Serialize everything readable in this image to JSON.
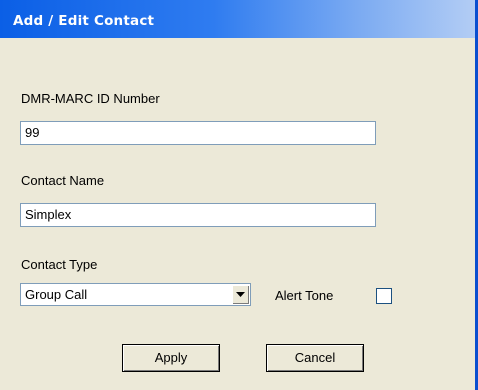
{
  "window": {
    "title": "Add / Edit Contact"
  },
  "form": {
    "id_label": "DMR-MARC ID Number",
    "id_value": "99",
    "name_label": "Contact Name",
    "name_value": "Simplex",
    "type_label": "Contact Type",
    "type_value": "Group Call",
    "alert_label": "Alert Tone",
    "alert_checked": false
  },
  "buttons": {
    "apply_label": "Apply",
    "cancel_label": "Cancel"
  },
  "colors": {
    "title_bar": "#0b5fe6",
    "dialog_bg": "#ece9d8",
    "input_border": "#7f9db9"
  },
  "icons": {
    "dropdown": "chevron-down-icon"
  }
}
